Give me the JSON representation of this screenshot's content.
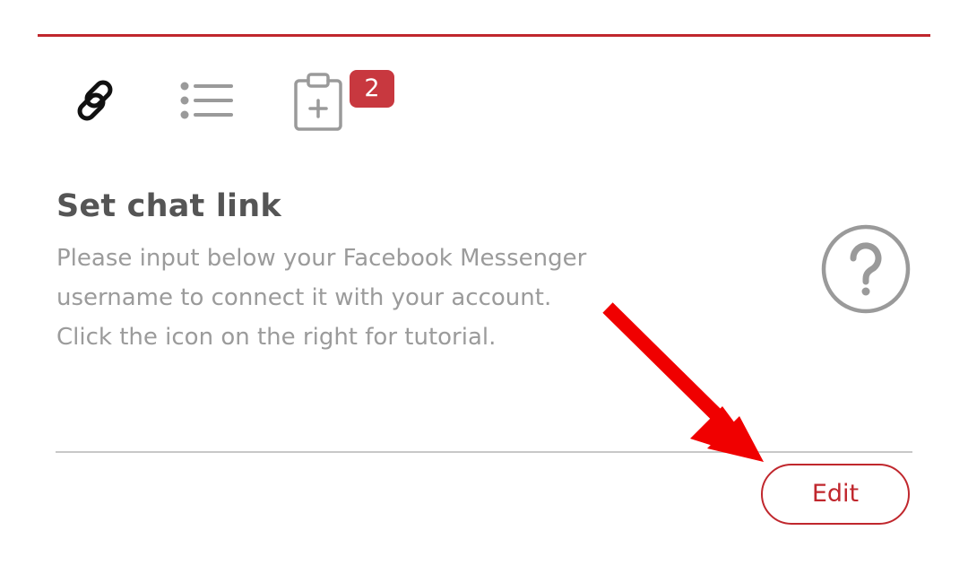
{
  "toolbar": {
    "icons": [
      "link-icon",
      "list-icon",
      "clipboard-plus-icon"
    ],
    "badge_count": "2"
  },
  "section": {
    "title": "Set chat link",
    "description_lines": [
      "Please input below your Facebook Messenger",
      "username to connect it with your account.",
      "Click the icon on the right for tutorial."
    ],
    "help_icon": "question-circle-icon"
  },
  "actions": {
    "edit_label": "Edit"
  },
  "annotation": {
    "arrow_icon": "red-arrow-icon"
  },
  "colors": {
    "accent": "#c0272d",
    "badge": "#c8383f",
    "title_text": "#555555",
    "body_text": "#9b9b9b",
    "icon_gray": "#9a9a9a",
    "divider": "#c8c8c8",
    "arrow": "#f00000"
  }
}
